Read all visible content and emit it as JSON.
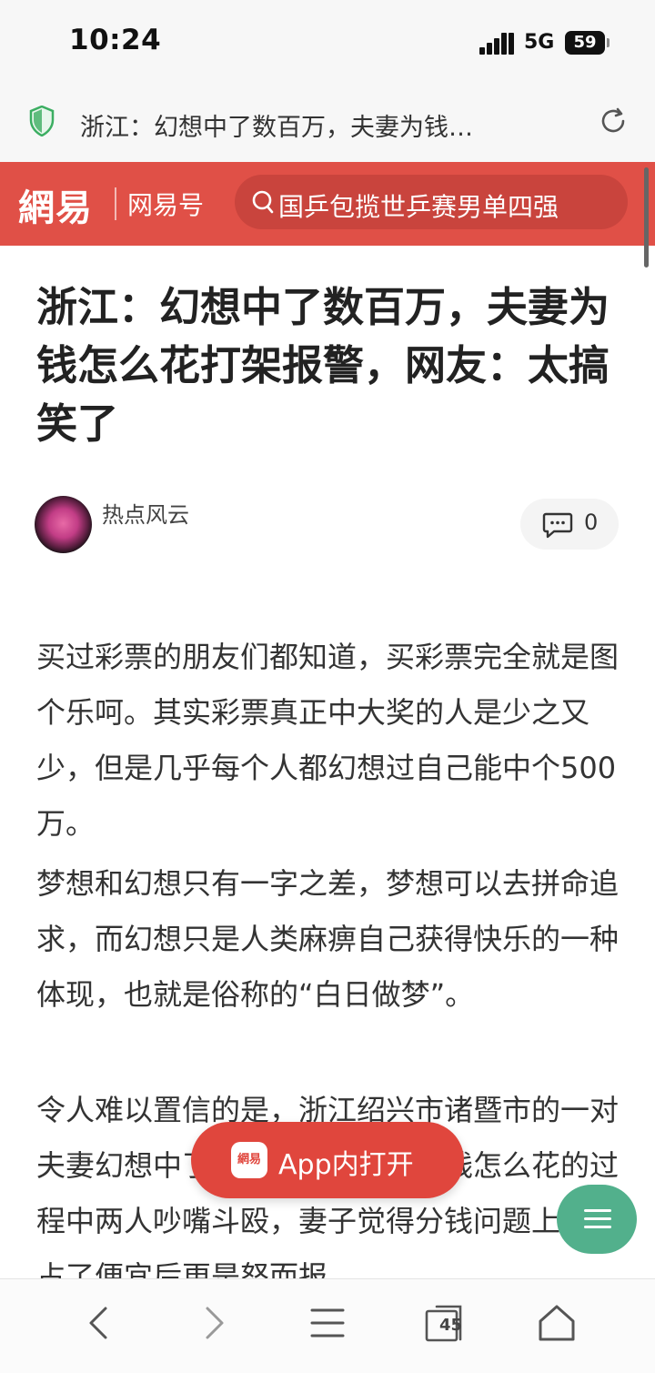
{
  "status_bar": {
    "time": "10:24",
    "network": "5G",
    "battery": "59"
  },
  "url_bar": {
    "text": "浙江：幻想中了数百万，夫妻为钱…"
  },
  "header": {
    "logo": "網易",
    "channel": "网易号",
    "search_text": "国乒包揽世乒赛男单四强",
    "brand_color": "#e05047"
  },
  "article": {
    "title": "浙江：幻想中了数百万，夫妻为钱怎么花打架报警，网友：太搞笑了",
    "author": "热点风云",
    "comment_count": "0",
    "paragraphs": [
      "买过彩票的朋友们都知道，买彩票完全就是图个乐呵。其实彩票真正中大奖的人是少之又少，但是几乎每个人都幻想过自己能中个500万。",
      "梦想和幻想只有一字之差，梦想可以去拼命追求，而幻想只是人类麻痹自己获得快乐的一种体现，也就是俗称的“白日做梦”。",
      "令人难以置信的是，浙江绍兴市诸暨市的一对夫妻幻想中了数百万，因为谈论钱怎么花的过程中两人吵嘴斗殴，妻子觉得分钱问题上丈夫占了便宜后更是怒而报"
    ]
  },
  "floating": {
    "app_logo": "網易",
    "open_app_label": "App内打开"
  },
  "bottom_bar": {
    "tabs_count": "45"
  }
}
